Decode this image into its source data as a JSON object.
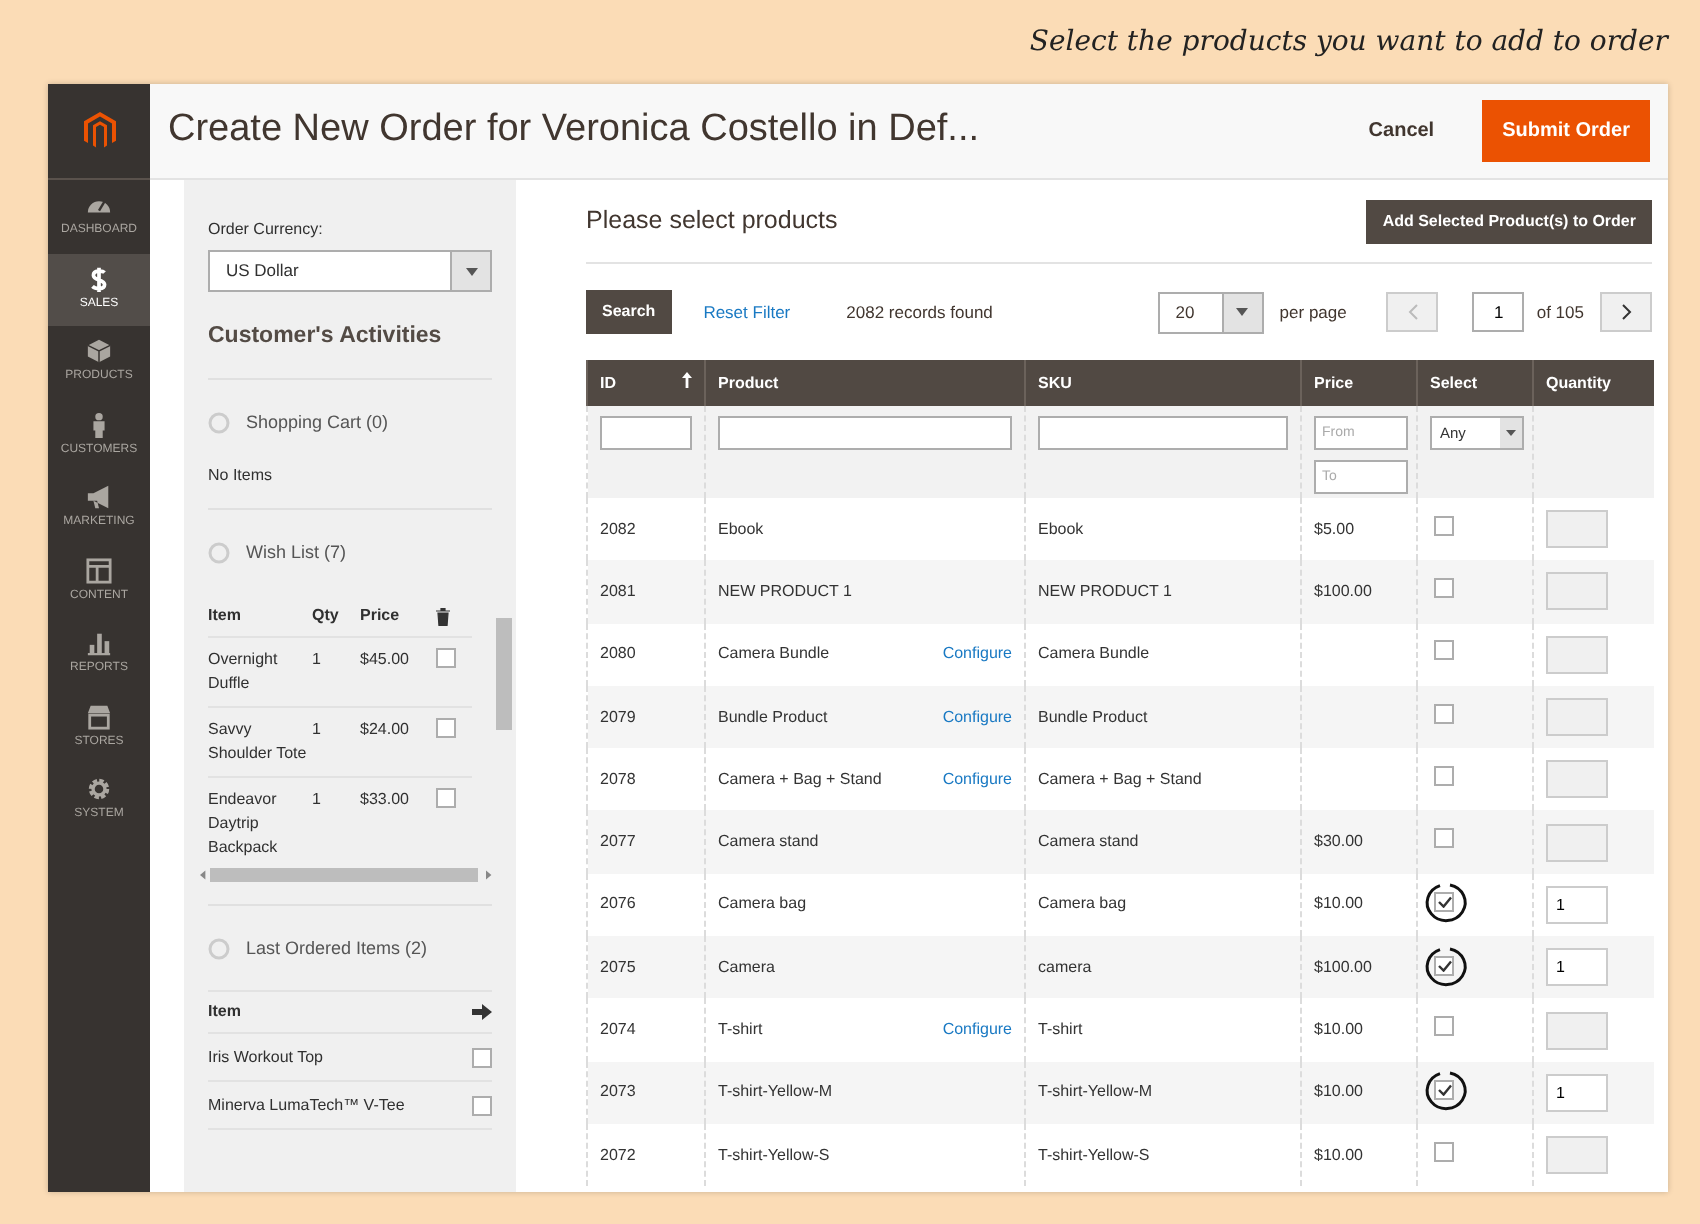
{
  "caption": "Select the products you want to add to order",
  "header": {
    "title": "Create New Order for Veronica Costello in Def...",
    "cancel": "Cancel",
    "submit": "Submit Order"
  },
  "sidebar": {
    "items": [
      {
        "label": "DASHBOARD",
        "selected": false
      },
      {
        "label": "SALES",
        "selected": true
      },
      {
        "label": "PRODUCTS",
        "selected": false
      },
      {
        "label": "CUSTOMERS",
        "selected": false
      },
      {
        "label": "MARKETING",
        "selected": false
      },
      {
        "label": "CONTENT",
        "selected": false
      },
      {
        "label": "REPORTS",
        "selected": false
      },
      {
        "label": "STORES",
        "selected": false
      },
      {
        "label": "SYSTEM",
        "selected": false
      }
    ]
  },
  "left_panel": {
    "currency_label": "Order Currency:",
    "currency": "US Dollar",
    "heading": "Customer's Activities",
    "shopping_cart": {
      "title": "Shopping Cart (0)",
      "empty": "No Items"
    },
    "wish_list": {
      "title": "Wish List (7)",
      "columns": [
        "Item",
        "Qty",
        "Price"
      ],
      "rows": [
        {
          "item": "Overnight Duffle",
          "qty": "1",
          "price": "$45.00",
          "checked": false
        },
        {
          "item": "Savvy Shoulder Tote",
          "qty": "1",
          "price": "$24.00",
          "checked": false
        },
        {
          "item": "Endeavor Daytrip Backpack",
          "qty": "1",
          "price": "$33.00",
          "checked": false
        }
      ]
    },
    "last_ordered": {
      "title": "Last Ordered Items (2)",
      "column": "Item",
      "rows": [
        {
          "item": "Iris Workout Top",
          "checked": false
        },
        {
          "item": "Minerva LumaTech™ V-Tee",
          "checked": false
        }
      ]
    }
  },
  "products": {
    "title": "Please select products",
    "add_button": "Add Selected Product(s) to Order",
    "search": "Search",
    "reset": "Reset Filter",
    "records": "2082 records found",
    "per_page_value": "20",
    "per_page": "per page",
    "page": "1",
    "of_pages": "of 105",
    "columns": [
      "ID",
      "Product",
      "SKU",
      "Price",
      "Select",
      "Quantity"
    ],
    "filters": {
      "price_from": {
        "placeholder": "From"
      },
      "price_to": {
        "placeholder": "To"
      },
      "select": "Any"
    },
    "rows": [
      {
        "id": "2082",
        "product": "Ebook",
        "sku": "Ebook",
        "price": "$5.00",
        "checked": false,
        "circled": false
      },
      {
        "id": "2081",
        "product": "NEW PRODUCT 1",
        "sku": "NEW PRODUCT 1",
        "price": "$100.00",
        "checked": false,
        "circled": false
      },
      {
        "id": "2080",
        "product": "Camera Bundle",
        "configure": "Configure",
        "sku": "Camera Bundle",
        "checked": false,
        "circled": false
      },
      {
        "id": "2079",
        "product": "Bundle Product",
        "configure": "Configure",
        "sku": "Bundle Product",
        "checked": false,
        "circled": false
      },
      {
        "id": "2078",
        "product": "Camera + Bag + Stand",
        "configure": "Configure",
        "sku": "Camera + Bag + Stand",
        "checked": false,
        "circled": false
      },
      {
        "id": "2077",
        "product": "Camera stand",
        "sku": "Camera stand",
        "price": "$30.00",
        "checked": false,
        "circled": false
      },
      {
        "id": "2076",
        "product": "Camera bag",
        "sku": "Camera bag",
        "price": "$10.00",
        "checked": true,
        "circled": true,
        "quantity": "1"
      },
      {
        "id": "2075",
        "product": "Camera",
        "sku": "camera",
        "price": "$100.00",
        "checked": true,
        "circled": true,
        "quantity": "1"
      },
      {
        "id": "2074",
        "product": "T-shirt",
        "configure": "Configure",
        "sku": "T-shirt",
        "price": "$10.00",
        "checked": false,
        "circled": false
      },
      {
        "id": "2073",
        "product": "T-shirt-Yellow-M",
        "sku": "T-shirt-Yellow-M",
        "price": "$10.00",
        "checked": true,
        "circled": true,
        "quantity": "1"
      },
      {
        "id": "2072",
        "product": "T-shirt-Yellow-S",
        "sku": "T-shirt-Yellow-S",
        "price": "$10.00",
        "checked": false,
        "circled": false
      }
    ]
  }
}
